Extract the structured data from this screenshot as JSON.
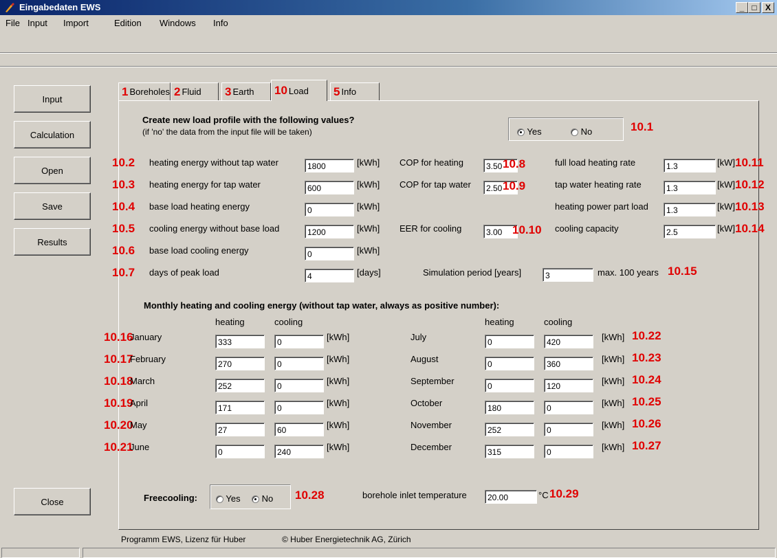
{
  "window": {
    "title": "Eingabedaten EWS",
    "buttons": [
      "_",
      "□",
      "X"
    ]
  },
  "menu": [
    "File",
    "Input",
    "Import",
    "Edition",
    "Windows",
    "Info"
  ],
  "sidebar": {
    "input": "Input",
    "calculation": "Calculation",
    "open": "Open",
    "save": "Save",
    "results": "Results",
    "close": "Close"
  },
  "tabs": [
    {
      "num": "1",
      "label": "Boreholes"
    },
    {
      "num": "2",
      "label": "Fluid"
    },
    {
      "num": "3",
      "label": "Earth"
    },
    {
      "num": "10",
      "label": "Load"
    },
    {
      "num": "5",
      "label": "Info"
    }
  ],
  "profile": {
    "question": "Create new load profile with the following values?",
    "note": "(if 'no' the data from the input file will be taken)",
    "yes": "Yes",
    "no": "No",
    "selected": "Yes",
    "num": "10.1"
  },
  "left_fields": [
    {
      "num": "10.2",
      "label": "heating energy without tap water",
      "value": "1800",
      "unit": "[kWh]"
    },
    {
      "num": "10.3",
      "label": "heating energy for tap water",
      "value": "600",
      "unit": "[kWh]"
    },
    {
      "num": "10.4",
      "label": "base load heating energy",
      "value": "0",
      "unit": "[kWh]"
    },
    {
      "num": "10.5",
      "label": "cooling energy without base load",
      "value": "1200",
      "unit": "[kWh]"
    },
    {
      "num": "10.6",
      "label": "base load cooling energy",
      "value": "0",
      "unit": "[kWh]"
    },
    {
      "num": "10.7",
      "label": "days of peak load",
      "value": "4",
      "unit": "[days]"
    }
  ],
  "mid_fields": [
    {
      "label": "COP for heating",
      "value": "3.50",
      "num": "10.8"
    },
    {
      "label": "COP for tap water",
      "value": "2.50",
      "num": "10.9"
    },
    {
      "label": "EER for cooling",
      "value": "3.00",
      "num": "10.10"
    }
  ],
  "right_fields": [
    {
      "label": "full load heating rate",
      "value": "1.3",
      "unit": "[kW]",
      "num": "10.11"
    },
    {
      "label": "tap water heating rate",
      "value": "1.3",
      "unit": "[kW]",
      "num": "10.12"
    },
    {
      "label": "heating power part load",
      "value": "1.3",
      "unit": "[kW]",
      "num": "10.13"
    },
    {
      "label": "cooling capacity",
      "value": "2.5",
      "unit": "[kW]",
      "num": "10.14"
    }
  ],
  "simulation": {
    "label": "Simulation period [years]",
    "value": "3",
    "max": "max. 100 years",
    "num": "10.15"
  },
  "monthly": {
    "title": "Monthly heating and cooling energy (without tap water, always as positive number):",
    "heating": "heating",
    "cooling": "cooling",
    "unit": "[kWh]",
    "left": [
      {
        "num": "10.16",
        "month": "January",
        "heating": "333",
        "cooling": "0"
      },
      {
        "num": "10.17",
        "month": "February",
        "heating": "270",
        "cooling": "0"
      },
      {
        "num": "10.18",
        "month": "March",
        "heating": "252",
        "cooling": "0"
      },
      {
        "num": "10.19",
        "month": "April",
        "heating": "171",
        "cooling": "0"
      },
      {
        "num": "10.20",
        "month": "May",
        "heating": "27",
        "cooling": "60"
      },
      {
        "num": "10.21",
        "month": "June",
        "heating": "0",
        "cooling": "240"
      }
    ],
    "right": [
      {
        "num": "10.22",
        "month": "July",
        "heating": "0",
        "cooling": "420"
      },
      {
        "num": "10.23",
        "month": "August",
        "heating": "0",
        "cooling": "360"
      },
      {
        "num": "10.24",
        "month": "September",
        "heating": "0",
        "cooling": "120"
      },
      {
        "num": "10.25",
        "month": "October",
        "heating": "180",
        "cooling": "0"
      },
      {
        "num": "10.26",
        "month": "November",
        "heating": "252",
        "cooling": "0"
      },
      {
        "num": "10.27",
        "month": "December",
        "heating": "315",
        "cooling": "0"
      }
    ]
  },
  "freecooling": {
    "label": "Freecooling:",
    "yes": "Yes",
    "no": "No",
    "selected": "No",
    "num": "10.28"
  },
  "inlet": {
    "label": "borehole inlet temperature",
    "value": "20.00",
    "unit": "°C",
    "num": "10.29"
  },
  "footer": {
    "program": "Programm EWS, Lizenz für Huber",
    "copyright": "© Huber Energietechnik AG, Zürich"
  }
}
